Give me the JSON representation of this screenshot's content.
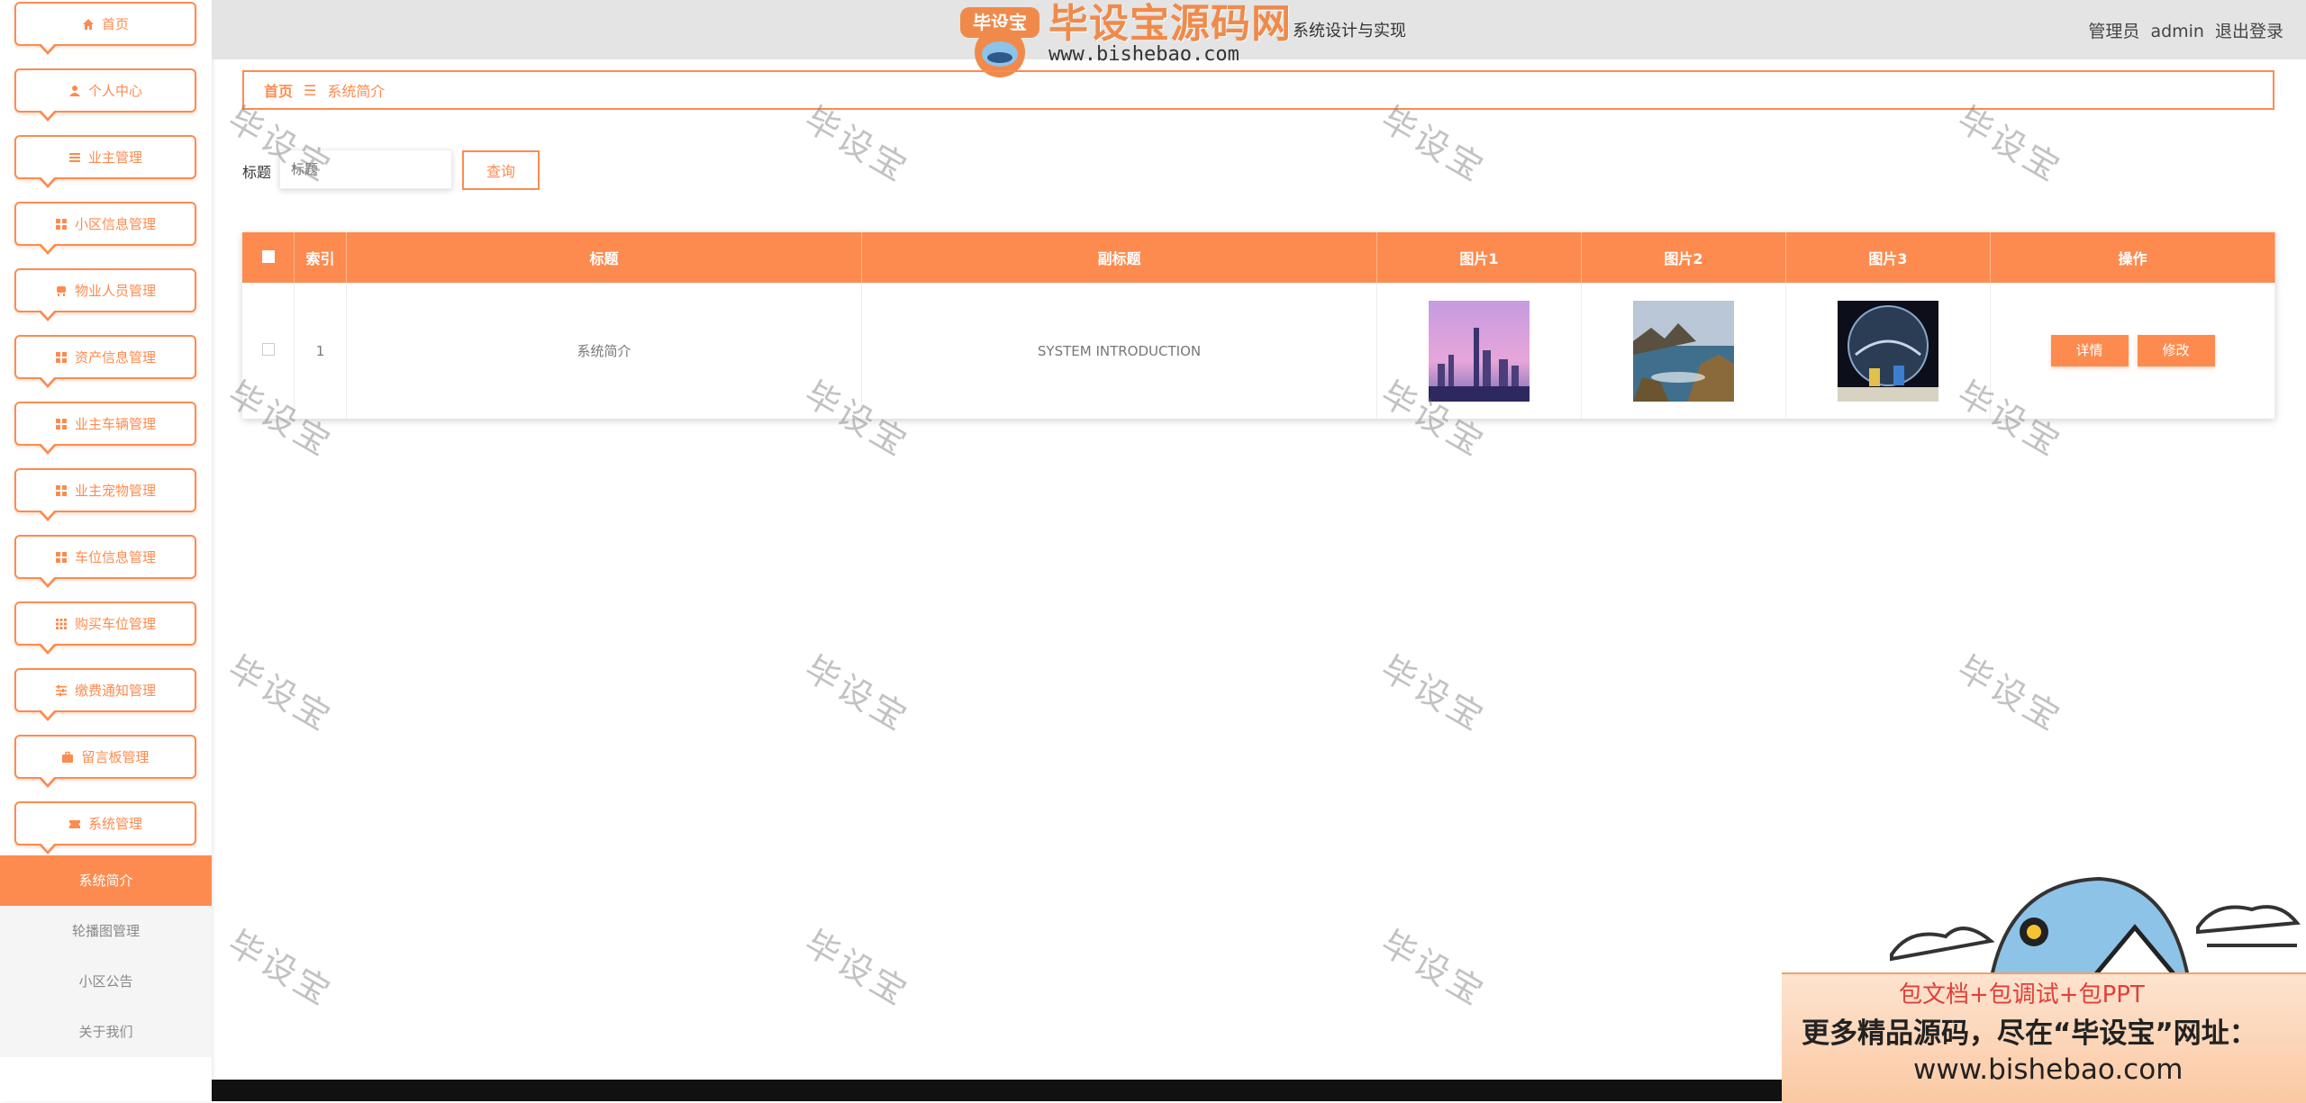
{
  "sidebar": {
    "menu": [
      {
        "label": "首页",
        "icon": "home-icon"
      },
      {
        "label": "个人中心",
        "icon": "user-icon"
      },
      {
        "label": "业主管理",
        "icon": "list-icon"
      },
      {
        "label": "小区信息管理",
        "icon": "grid-icon"
      },
      {
        "label": "物业人员管理",
        "icon": "seat-icon"
      },
      {
        "label": "资产信息管理",
        "icon": "grid-icon"
      },
      {
        "label": "业主车辆管理",
        "icon": "grid-icon"
      },
      {
        "label": "业主宠物管理",
        "icon": "grid-icon"
      },
      {
        "label": "车位信息管理",
        "icon": "grid-icon"
      },
      {
        "label": "购买车位管理",
        "icon": "apps-icon"
      },
      {
        "label": "缴费通知管理",
        "icon": "sliders-icon"
      },
      {
        "label": "留言板管理",
        "icon": "briefcase-icon"
      },
      {
        "label": "系统管理",
        "icon": "ticket-icon"
      }
    ],
    "submenu": [
      {
        "label": "系统简介",
        "active": true
      },
      {
        "label": "轮播图管理",
        "active": false
      },
      {
        "label": "小区公告",
        "active": false
      },
      {
        "label": "关于我们",
        "active": false
      }
    ]
  },
  "topbar": {
    "title": "系统设计与实现",
    "role": "管理员",
    "username": "admin",
    "logout": "退出登录"
  },
  "logo": {
    "badge": "毕设宝",
    "name": "毕设宝源码网",
    "url": "www.bishebao.com"
  },
  "breadcrumb": {
    "home": "首页",
    "separator": "☰",
    "current": "系统简介"
  },
  "search": {
    "label": "标题",
    "placeholder": "标题",
    "button": "查询"
  },
  "table": {
    "columns": [
      "索引",
      "标题",
      "副标题",
      "图片1",
      "图片2",
      "图片3",
      "操作"
    ],
    "rows": [
      {
        "index": "1",
        "title": "系统简介",
        "subtitle": "SYSTEM INTRODUCTION",
        "images": [
          "city-skyline-image",
          "coastal-rocks-image",
          "space-astronaut-image"
        ],
        "actions": [
          "详情",
          "修改"
        ]
      }
    ]
  },
  "watermark": "毕设宝",
  "promo": {
    "line1": "包文档+包调试+包PPT",
    "line2": "更多精品源码，尽在“毕设宝”网址：",
    "line3": "www.bishebao.com"
  },
  "colors": {
    "accent": "#fd8b4f",
    "topbar": "#e4e4e4",
    "submenu_bg": "#f5f5f5"
  }
}
